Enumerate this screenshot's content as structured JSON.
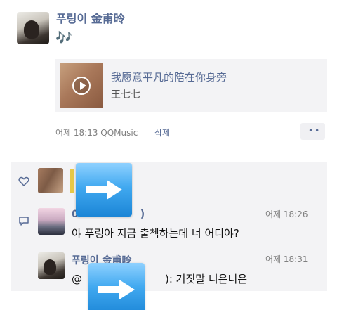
{
  "post": {
    "author": "푸링이 金甫昤",
    "text": "🎶",
    "music": {
      "title": "我愿意平凡的陪在你身旁",
      "artist": "王七七"
    },
    "time_source": "어제 18:13  QQMusic",
    "delete_label": "삭제",
    "more_label": "••"
  },
  "comments": [
    {
      "name_visible": "0",
      "name_suffix": ")",
      "time": "어제 18:26",
      "text": "야 푸링아 지금 출첵하는데 너 어디야?"
    },
    {
      "name": "푸링이 金甫昤",
      "time": "어제 18:31",
      "text_prefix": "@",
      "text_suffix": "): 거짓말 니은니은"
    }
  ],
  "colors": {
    "link": "#576b95",
    "panel": "#f3f3f5",
    "arrow": "#41a9f0"
  },
  "icons": {
    "like": "heart-icon",
    "comment": "comment-icon",
    "play": "play-icon",
    "overlay": "right-arrow-icon"
  }
}
